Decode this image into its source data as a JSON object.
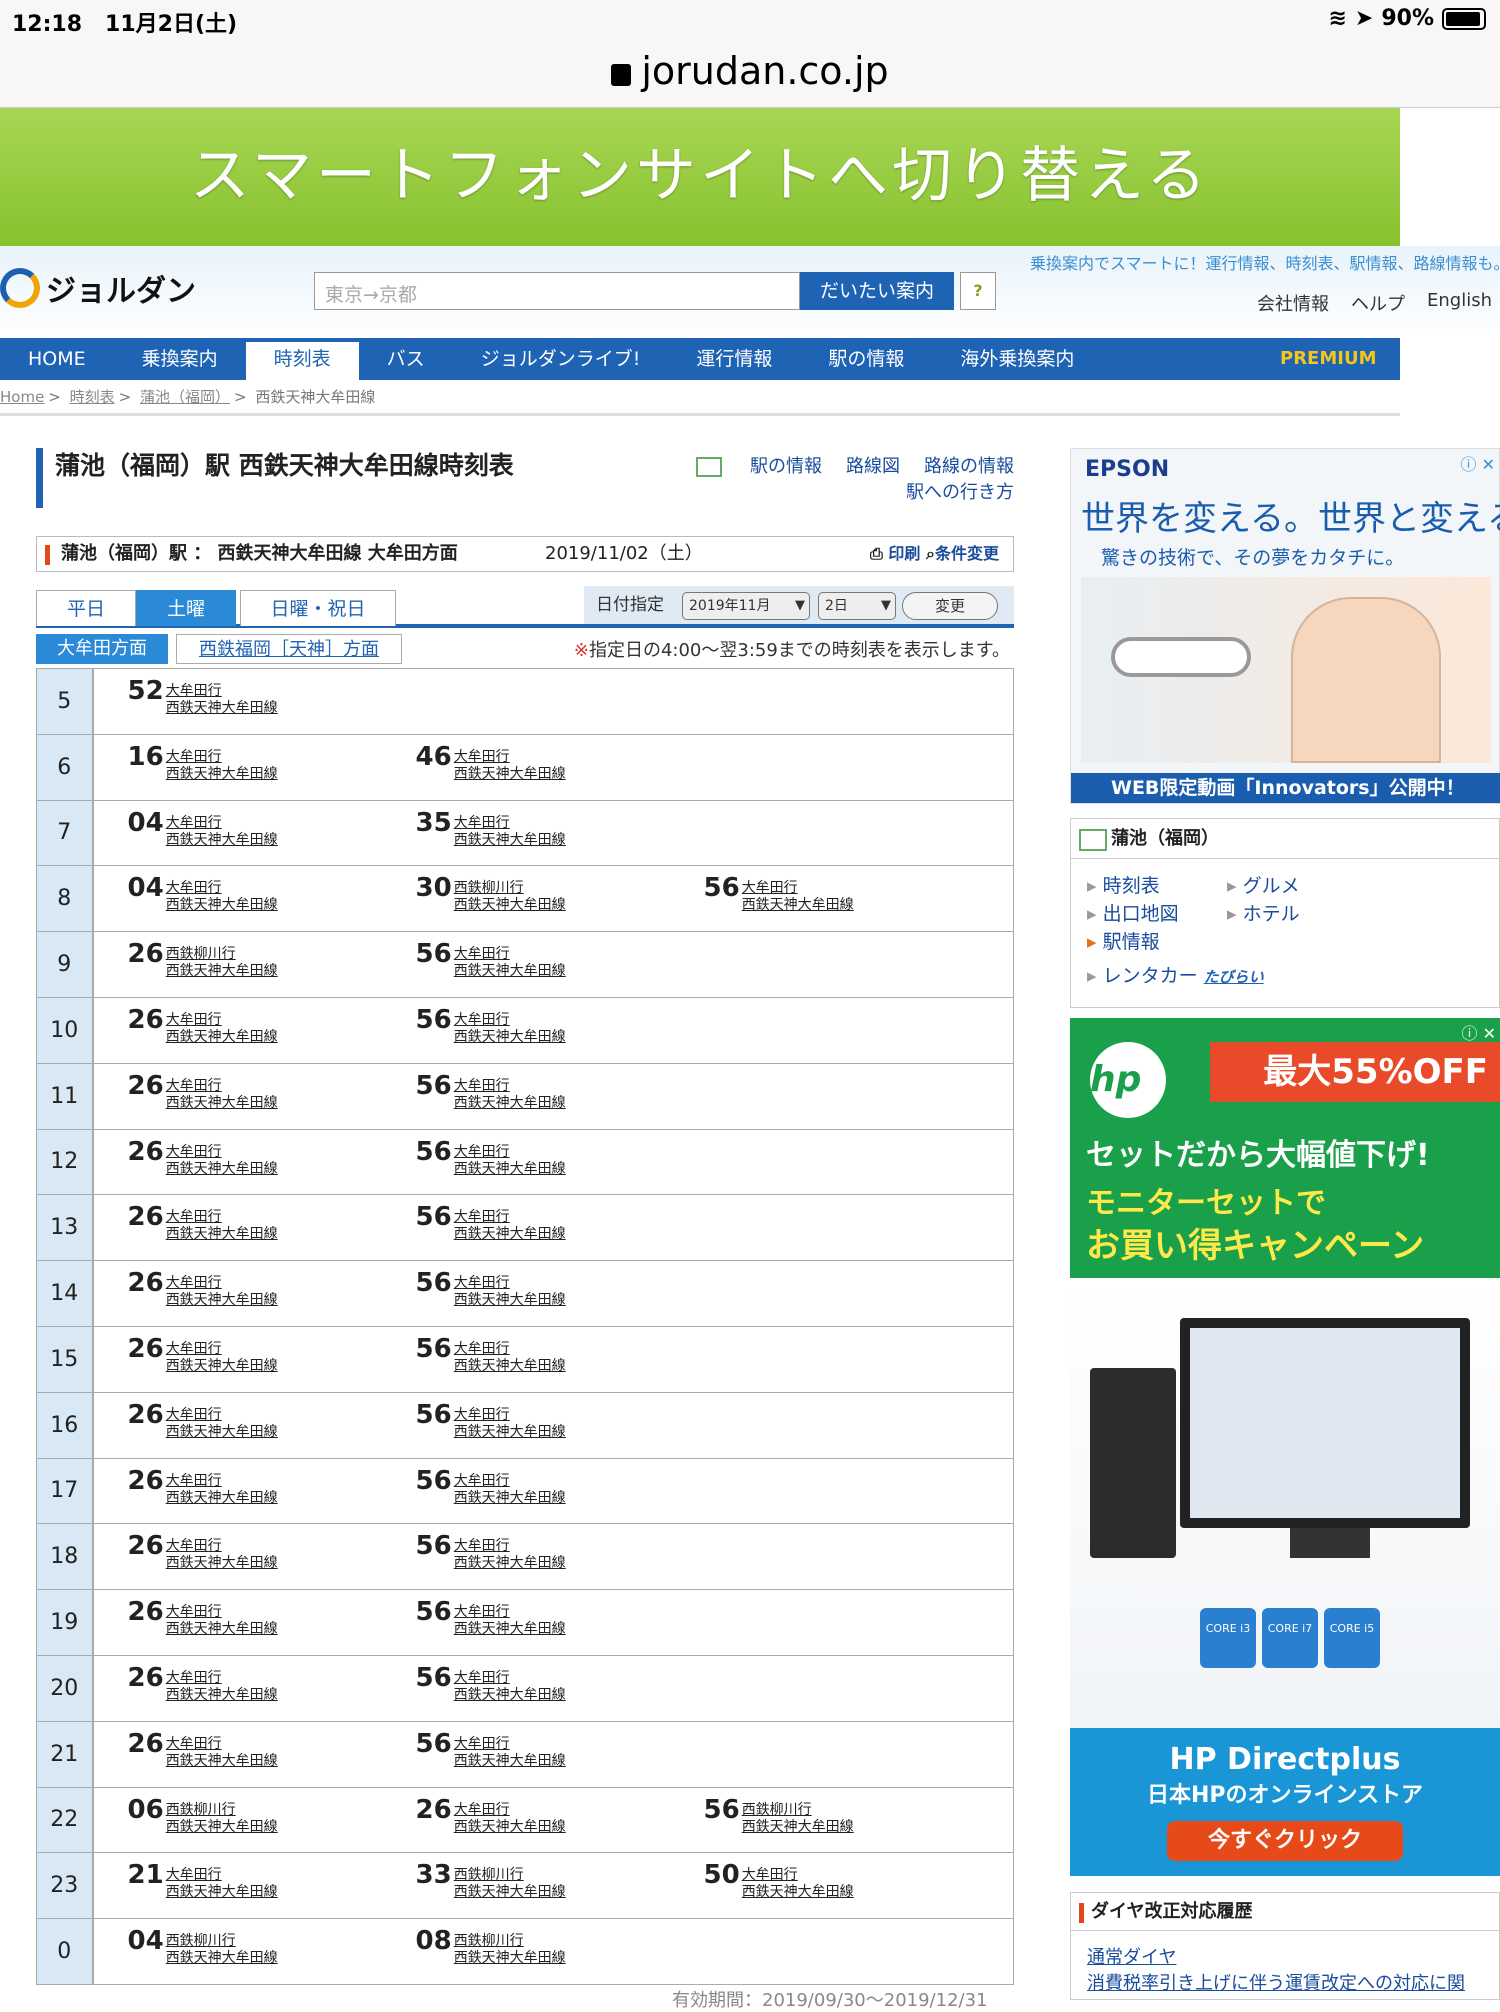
{
  "status": {
    "time": "12:18",
    "date": "11月2日(土)",
    "battery": "90%"
  },
  "browser": {
    "url": "jorudan.co.jp"
  },
  "banner": {
    "label": "スマートフォンサイトへ切り替える"
  },
  "header": {
    "logo": "ジョルダン",
    "search_placeholder": "東京→京都",
    "search_button": "だいたい案内",
    "help_button": "?",
    "tagline": "乗換案内でスマートに！運行情報、時刻表、駅情報、路線情報も。",
    "links": [
      "会社情報",
      "ヘルプ",
      "English"
    ]
  },
  "nav": {
    "items": [
      "HOME",
      "乗換案内",
      "時刻表",
      "バス",
      "ジョルダンライブ!",
      "運行情報",
      "駅の情報",
      "海外乗換案内"
    ],
    "premium": "PREMIUM"
  },
  "breadcrumb": {
    "items": [
      "Home",
      "時刻表",
      "蒲池（福岡）",
      "西鉄天神大牟田線"
    ]
  },
  "page": {
    "title": "蒲池（福岡）駅 西鉄天神大牟田線時刻表",
    "links": {
      "station": "駅の情報",
      "route_map": "路線図",
      "route_info": "路線の情報",
      "access": "駅への行き方"
    }
  },
  "subbar": {
    "label": "蒲池（福岡）駅 ： 西鉄天神大牟田線 大牟田方面",
    "date": "2019/11/02（土）",
    "print": "印刷",
    "change_cond": "条件変更"
  },
  "tabs": {
    "weekday": "平日",
    "saturday": "土曜",
    "holiday": "日曜・祝日"
  },
  "datepick": {
    "label": "日付指定",
    "month": "2019年11月",
    "day": "2日",
    "change": "変更"
  },
  "directions": {
    "active": "大牟田方面",
    "other": "西鉄福岡［天神］方面"
  },
  "note": {
    "mark": "※",
    "text": "指定日の4:00〜翌3:59までの時刻表を表示します。"
  },
  "line": "西鉄天神大牟田線",
  "timetable": [
    {
      "hour": "5",
      "deps": [
        {
          "m": "52",
          "dest": "大牟田行"
        }
      ]
    },
    {
      "hour": "6",
      "deps": [
        {
          "m": "16",
          "dest": "大牟田行"
        },
        {
          "m": "46",
          "dest": "大牟田行"
        }
      ]
    },
    {
      "hour": "7",
      "deps": [
        {
          "m": "04",
          "dest": "大牟田行"
        },
        {
          "m": "35",
          "dest": "大牟田行"
        }
      ]
    },
    {
      "hour": "8",
      "deps": [
        {
          "m": "04",
          "dest": "大牟田行"
        },
        {
          "m": "30",
          "dest": "西鉄柳川行"
        },
        {
          "m": "56",
          "dest": "大牟田行"
        }
      ]
    },
    {
      "hour": "9",
      "deps": [
        {
          "m": "26",
          "dest": "西鉄柳川行"
        },
        {
          "m": "56",
          "dest": "大牟田行"
        }
      ]
    },
    {
      "hour": "10",
      "deps": [
        {
          "m": "26",
          "dest": "大牟田行"
        },
        {
          "m": "56",
          "dest": "大牟田行"
        }
      ]
    },
    {
      "hour": "11",
      "deps": [
        {
          "m": "26",
          "dest": "大牟田行"
        },
        {
          "m": "56",
          "dest": "大牟田行"
        }
      ]
    },
    {
      "hour": "12",
      "deps": [
        {
          "m": "26",
          "dest": "大牟田行"
        },
        {
          "m": "56",
          "dest": "大牟田行"
        }
      ]
    },
    {
      "hour": "13",
      "deps": [
        {
          "m": "26",
          "dest": "大牟田行"
        },
        {
          "m": "56",
          "dest": "大牟田行"
        }
      ]
    },
    {
      "hour": "14",
      "deps": [
        {
          "m": "26",
          "dest": "大牟田行"
        },
        {
          "m": "56",
          "dest": "大牟田行"
        }
      ]
    },
    {
      "hour": "15",
      "deps": [
        {
          "m": "26",
          "dest": "大牟田行"
        },
        {
          "m": "56",
          "dest": "大牟田行"
        }
      ]
    },
    {
      "hour": "16",
      "deps": [
        {
          "m": "26",
          "dest": "大牟田行"
        },
        {
          "m": "56",
          "dest": "大牟田行"
        }
      ]
    },
    {
      "hour": "17",
      "deps": [
        {
          "m": "26",
          "dest": "大牟田行"
        },
        {
          "m": "56",
          "dest": "大牟田行"
        }
      ]
    },
    {
      "hour": "18",
      "deps": [
        {
          "m": "26",
          "dest": "大牟田行"
        },
        {
          "m": "56",
          "dest": "大牟田行"
        }
      ]
    },
    {
      "hour": "19",
      "deps": [
        {
          "m": "26",
          "dest": "大牟田行"
        },
        {
          "m": "56",
          "dest": "大牟田行"
        }
      ]
    },
    {
      "hour": "20",
      "deps": [
        {
          "m": "26",
          "dest": "大牟田行"
        },
        {
          "m": "56",
          "dest": "大牟田行"
        }
      ]
    },
    {
      "hour": "21",
      "deps": [
        {
          "m": "26",
          "dest": "大牟田行"
        },
        {
          "m": "56",
          "dest": "大牟田行"
        }
      ]
    },
    {
      "hour": "22",
      "deps": [
        {
          "m": "06",
          "dest": "西鉄柳川行"
        },
        {
          "m": "26",
          "dest": "大牟田行"
        },
        {
          "m": "56",
          "dest": "西鉄柳川行"
        }
      ]
    },
    {
      "hour": "23",
      "deps": [
        {
          "m": "21",
          "dest": "大牟田行"
        },
        {
          "m": "33",
          "dest": "西鉄柳川行"
        },
        {
          "m": "50",
          "dest": "大牟田行"
        }
      ]
    },
    {
      "hour": "0",
      "deps": [
        {
          "m": "04",
          "dest": "西鉄柳川行"
        },
        {
          "m": "08",
          "dest": "西鉄柳川行"
        }
      ]
    }
  ],
  "validity": "有効期間：2019/09/30〜2019/12/31",
  "ad_epson": {
    "brand": "EPSON",
    "copy1": "世界を変える。世界と変える。",
    "copy2": "驚きの技術で、その夢をカタチに。",
    "bar": "WEB限定動画「Innovators」公開中！"
  },
  "station_box": {
    "title": "蒲池（福岡）",
    "links": [
      "時刻表",
      "グルメ",
      "出口地図",
      "ホテル",
      "駅情報",
      "レンタカー"
    ],
    "tabirai": "たびらい"
  },
  "ad_hp": {
    "logo": "hp",
    "discount": "最大55%OFF",
    "line1": "セットだから大幅値下げ!",
    "line2": "モニターセットで",
    "line3": "お買い得キャンペーン",
    "chips": [
      "CORE i3",
      "CORE i7",
      "CORE i5"
    ],
    "store": "HP Directplus",
    "store_sub": "日本HPのオンラインストア",
    "cta": "今すぐクリック"
  },
  "dia_box": {
    "title": "ダイヤ改正対応履歴",
    "link1": "通常ダイヤ",
    "link2": "消費税率引き上げに伴う運賃改定への対応に関"
  }
}
